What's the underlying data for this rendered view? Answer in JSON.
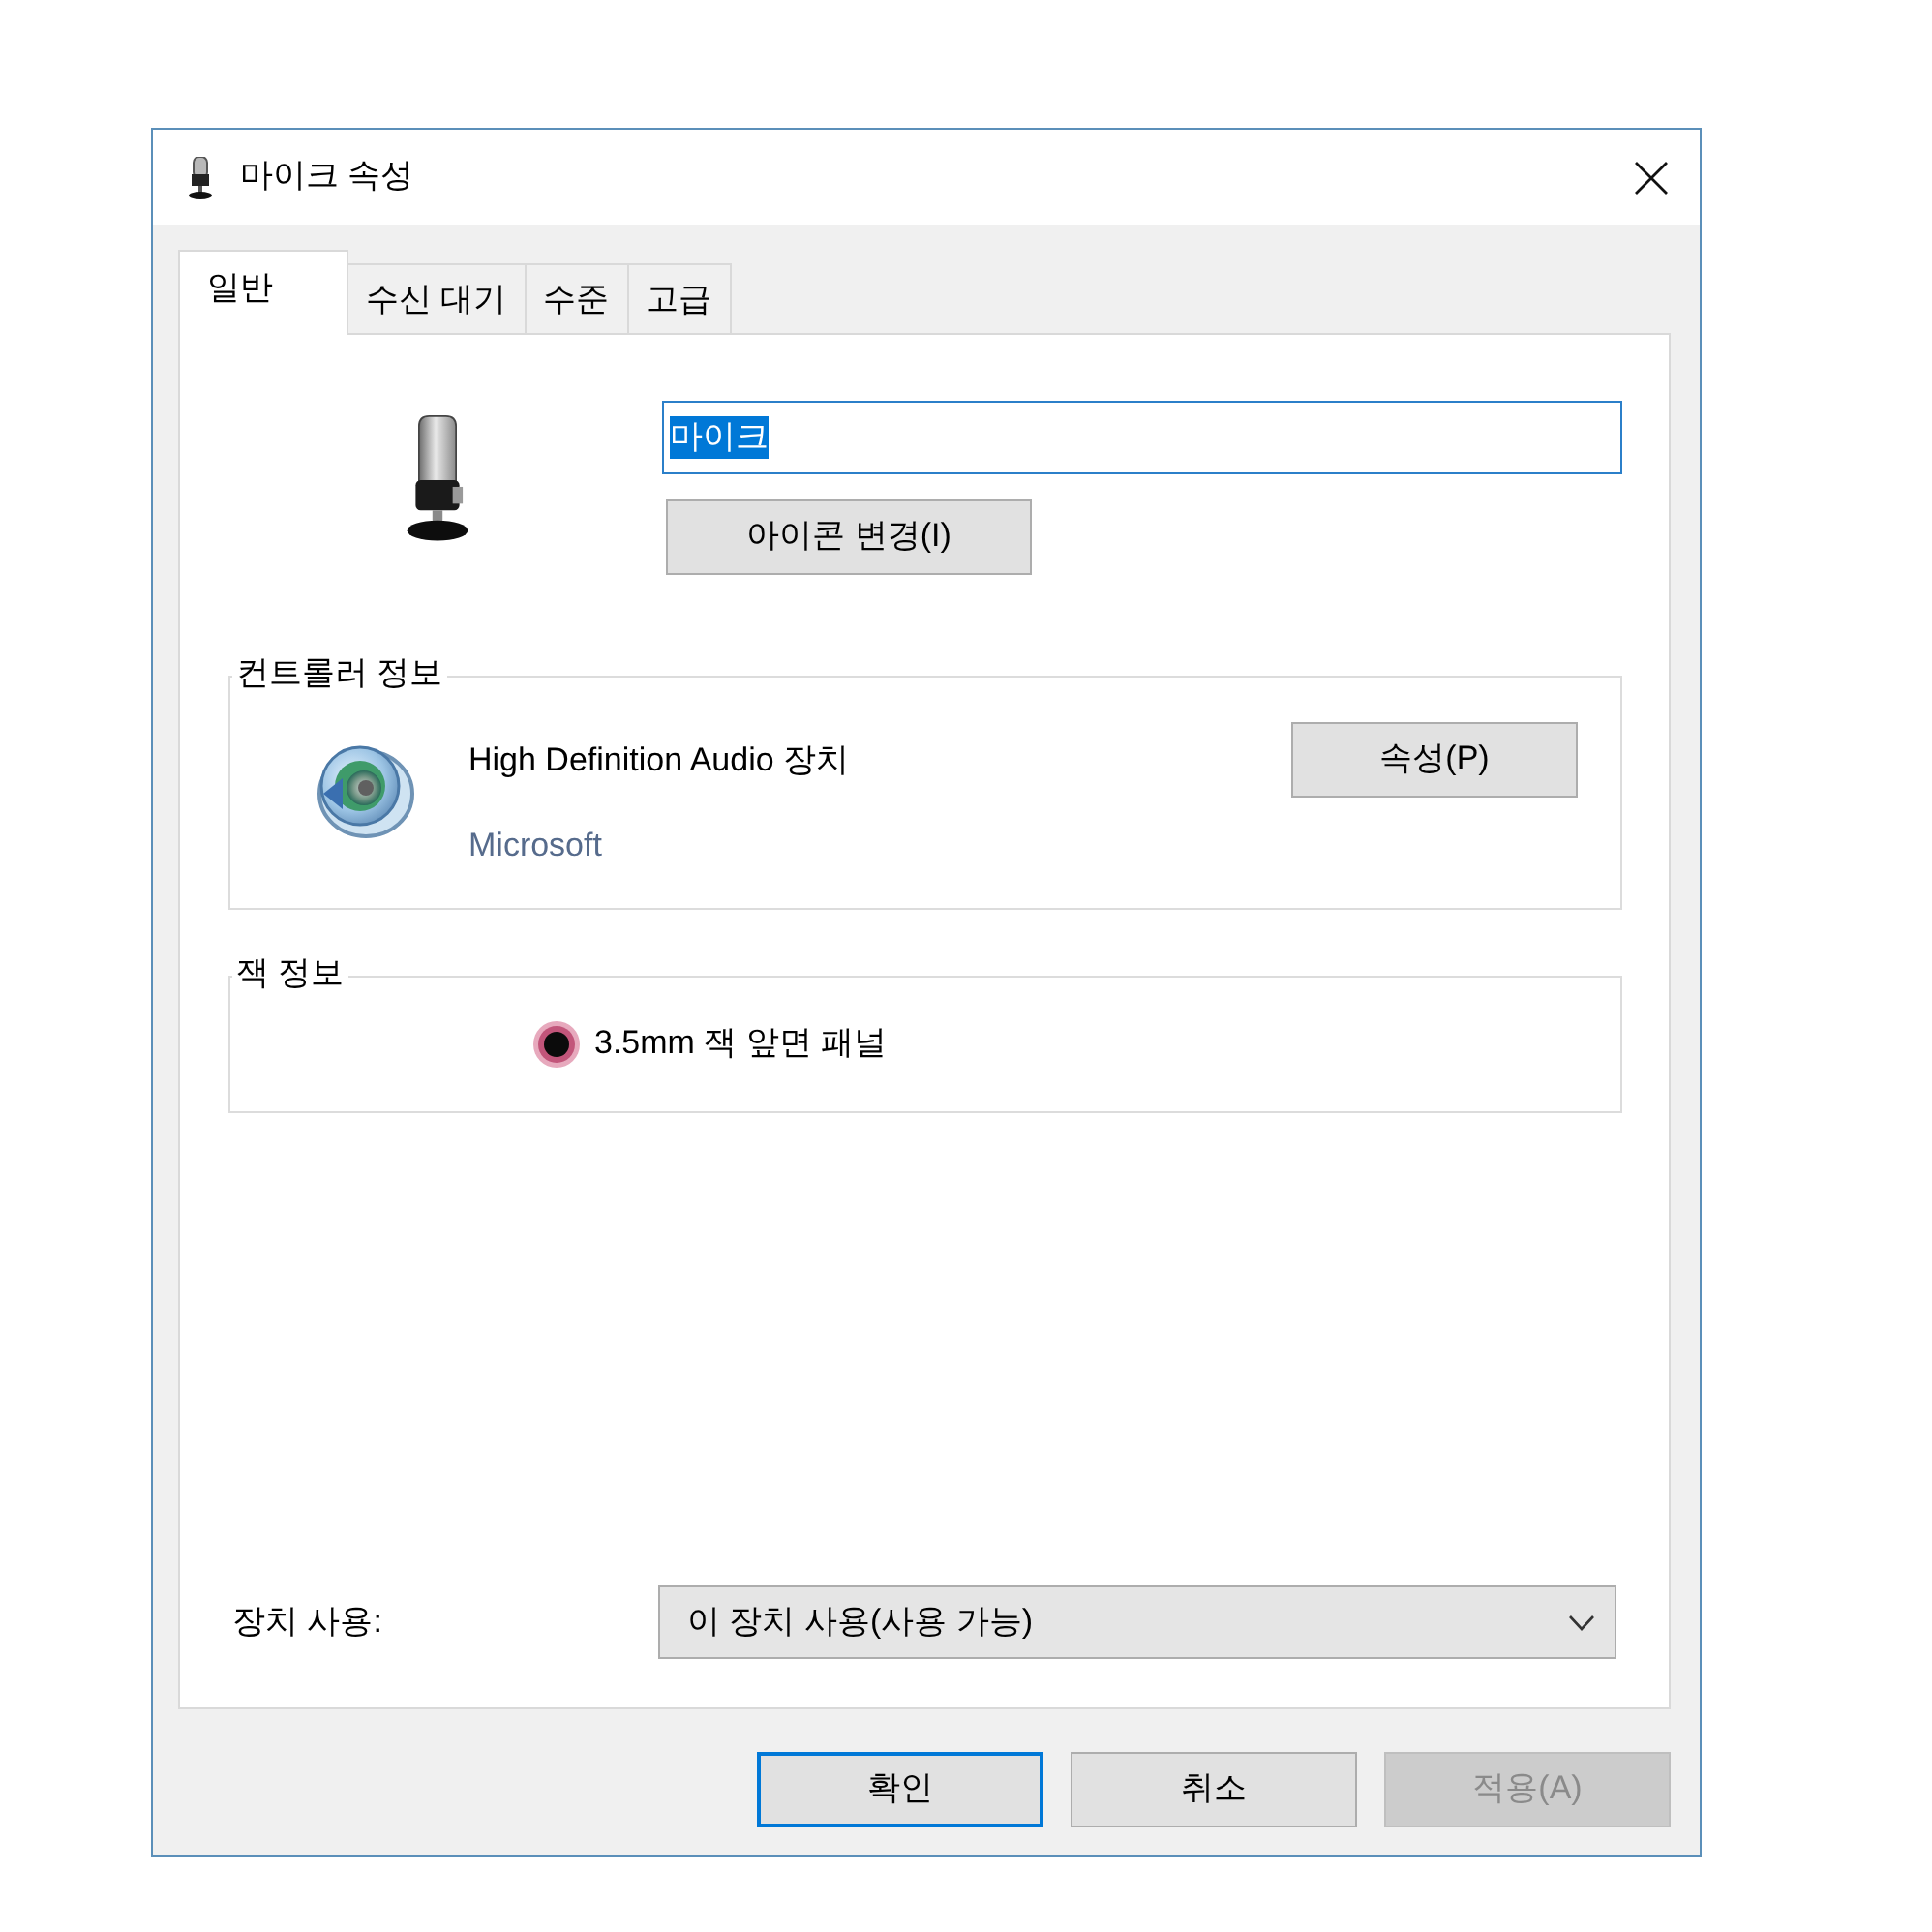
{
  "window": {
    "title": "마이크 속성"
  },
  "tabs": [
    {
      "label": "일반",
      "selected": true
    },
    {
      "label": "수신 대기",
      "selected": false
    },
    {
      "label": "수준",
      "selected": false
    },
    {
      "label": "고급",
      "selected": false
    }
  ],
  "device": {
    "name_field": {
      "value": "마이크",
      "selected": true
    },
    "change_icon_button": "아이콘 변경(I)"
  },
  "controller_info": {
    "title": "컨트롤러 정보",
    "name": "High Definition Audio 장치",
    "vendor": "Microsoft",
    "properties_button": "속성(P)"
  },
  "jack_info": {
    "title": "잭 정보",
    "jack": "3.5mm 잭 앞면 패널"
  },
  "device_usage": {
    "label": "장치 사용:",
    "value": "이 장치 사용(사용 가능)"
  },
  "buttons": [
    {
      "label": "확인",
      "default": true,
      "disabled": false
    },
    {
      "label": "취소",
      "default": false,
      "disabled": false
    },
    {
      "label": "적용(A)",
      "default": false,
      "disabled": true
    }
  ]
}
